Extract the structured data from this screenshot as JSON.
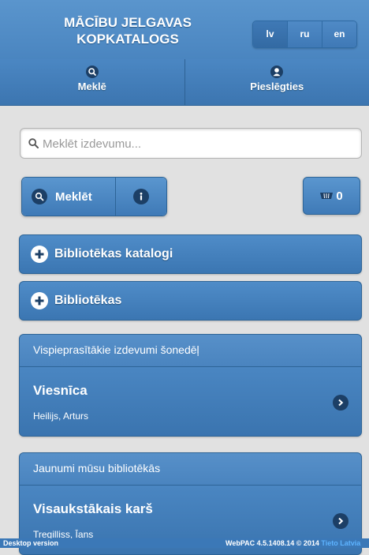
{
  "header": {
    "title_line1": "MĀCĪBU JELGAVAS",
    "title_line2": "KOPKATALOGS",
    "languages": [
      "lv",
      "ru",
      "en"
    ]
  },
  "nav": {
    "search_label": "Meklē",
    "login_label": "Pieslēgties"
  },
  "search": {
    "placeholder": "Meklēt izdevumu...",
    "value": "",
    "button_label": "Meklēt"
  },
  "cart": {
    "count": "0"
  },
  "collapsibles": [
    {
      "label": "Bibliotēkas katalogi"
    },
    {
      "label": "Bibliotēkas"
    }
  ],
  "popular": {
    "heading": "Vispieprasītākie izdevumi šonedēļ",
    "items": [
      {
        "title": "Viesnīca",
        "author": "Heilijs, Arturs"
      }
    ]
  },
  "new_items": {
    "heading": "Jaunumi mūsu bibliotēkās",
    "items": [
      {
        "title": "Visaukstākais karš",
        "author": "Tregilliss, Īans"
      }
    ]
  },
  "footer": {
    "desktop_link": "Desktop version",
    "version": "WebPAC 4.5.1408.14 © 2014",
    "credit": "Tieto Latvia"
  },
  "colors": {
    "accent": "#4a85c0",
    "icon_dark": "#1c3f66",
    "background": "#e1e1e1"
  }
}
